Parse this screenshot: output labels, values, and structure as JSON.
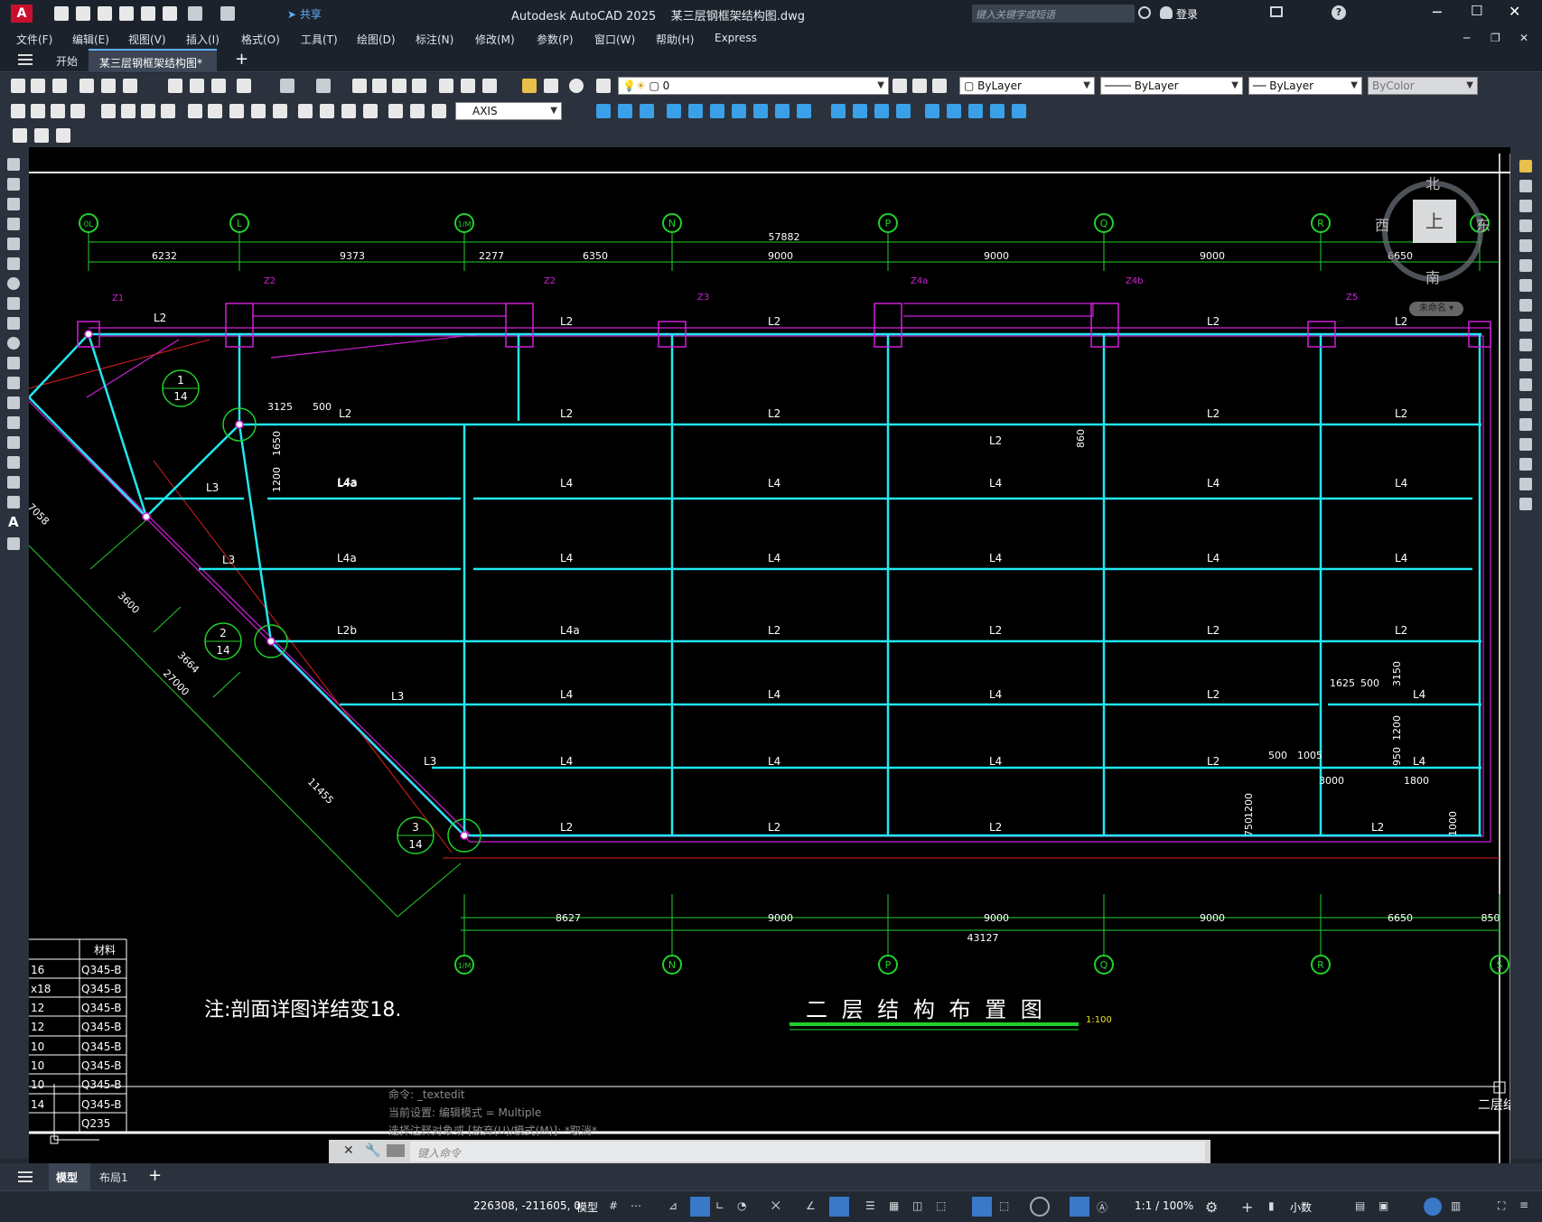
{
  "app": {
    "title": "Autodesk AutoCAD 2025    某三层钢框架结构图.dwg",
    "share_label": "共享",
    "search_placeholder": "键入关键字或短语",
    "login_label": "登录"
  },
  "menu": [
    "文件(F)",
    "编辑(E)",
    "视图(V)",
    "插入(I)",
    "格式(O)",
    "工具(T)",
    "绘图(D)",
    "标注(N)",
    "修改(M)",
    "参数(P)",
    "窗口(W)",
    "帮助(H)",
    "Express"
  ],
  "tabs": {
    "start": "开始",
    "file": "某三层钢框架结构图*"
  },
  "toolbar": {
    "layer_value": "0",
    "color_value": "ByLayer",
    "linetype_value": "ByLayer",
    "lineweight_value": "ByLayer",
    "plotstyle_value": "ByColor",
    "dimstyle_value": "AXIS"
  },
  "viewcube": {
    "north": "北",
    "south": "南",
    "west": "西",
    "east": "东",
    "top": "上",
    "wcs": "未命名"
  },
  "drawing": {
    "title": "二 层 结 构 布 置 图",
    "scale": "1:100",
    "note": "注:剖面详图详结变18.",
    "corner_label": "二层结",
    "top_axes": [
      "0L",
      "L",
      "1/M",
      "N",
      "P",
      "Q",
      "R",
      "S"
    ],
    "bottom_axes": [
      "1/M",
      "N",
      "P",
      "Q",
      "R",
      "S"
    ],
    "top_total": "57882",
    "top_dims": [
      "6232",
      "9373",
      "2277",
      "6350",
      "9000",
      "9000",
      "9000",
      "6650"
    ],
    "bottom_dims": [
      "8627",
      "9000",
      "9000",
      "9000",
      "6650",
      "850"
    ],
    "bottom_total": "43127",
    "columns": [
      "Z1",
      "Z2",
      "Z2",
      "Z3",
      "Z4a",
      "Z4b",
      "Z5"
    ],
    "material_header": "材料",
    "material_rows": [
      [
        "16",
        "Q345-B"
      ],
      [
        "x18",
        "Q345-B"
      ],
      [
        "12",
        "Q345-B"
      ],
      [
        "12",
        "Q345-B"
      ],
      [
        "10",
        "Q345-B"
      ],
      [
        "10",
        "Q345-B"
      ],
      [
        "10",
        "Q345-B"
      ],
      [
        "14",
        "Q345-B"
      ],
      [
        "",
        "Q235"
      ]
    ],
    "details": [
      {
        "n": "1",
        "d": "14"
      },
      {
        "n": "2",
        "d": "14"
      },
      {
        "n": "3",
        "d": "14"
      }
    ],
    "diag_dims": [
      "7058",
      "3600",
      "3664",
      "27000",
      "11455"
    ],
    "small_dims": [
      "3125",
      "500",
      "1650",
      "1200",
      "860",
      "1625",
      "500",
      "3150",
      "1200",
      "950",
      "500",
      "1005",
      "3000",
      "1800",
      "1200",
      "750",
      "1000"
    ]
  },
  "command": {
    "history": [
      "命令: _textedit",
      "当前设置: 编辑模式 = Multiple",
      "选择注释对象或 [放弃(U)/模式(M)]: *取消*"
    ],
    "placeholder": "键入命令"
  },
  "layout_tabs": [
    "模型",
    "布局1"
  ],
  "status": {
    "coords": "226308, -211605, 0",
    "model": "模型",
    "scale": "1:1 / 100%",
    "units": "小数"
  }
}
